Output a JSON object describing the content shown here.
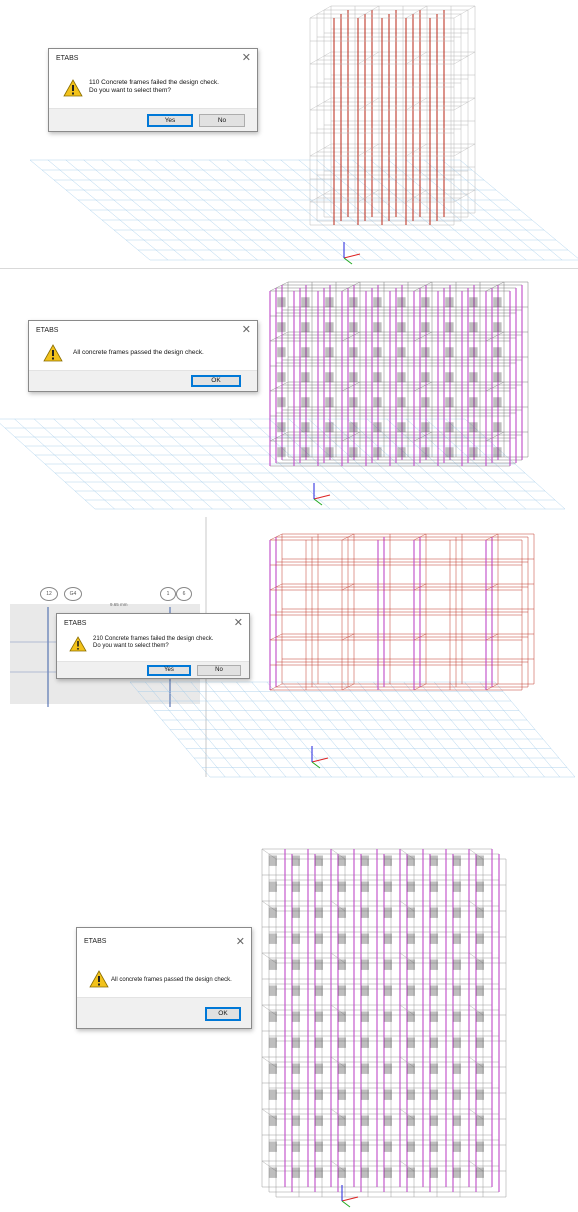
{
  "dialog1": {
    "title": "ETABS",
    "close": "✕",
    "message_line1": "110 Concrete frames failed the design check.",
    "message_line2": "Do you want to select them?",
    "yes_label": "Yes",
    "no_label": "No"
  },
  "dialog2": {
    "title": "ETABS",
    "close": "✕",
    "message": "All concrete frames passed the design check.",
    "ok_label": "OK"
  },
  "dialog3": {
    "title": "ETABS",
    "close": "✕",
    "message_line1": "210 Concrete frames failed the design check.",
    "message_line2": "Do you want to select them?",
    "yes_label": "Yes",
    "no_label": "No"
  },
  "dialog4": {
    "title": "ETABS",
    "close": "✕",
    "message": "All concrete frames passed the design check.",
    "ok_label": "OK"
  },
  "plan_view": {
    "grid_bubble_labels": [
      "12",
      "G4",
      "1",
      "6"
    ],
    "dimension_text": "9.65 mm"
  },
  "icons": {
    "warning": "warning-triangle-icon",
    "axes": "axes-triad-icon"
  },
  "colors": {
    "frame_grey": "#b8b8b8",
    "fail_red": "#c0392b",
    "pass_magenta": "#c04ac8",
    "ground_grid": "#9cc8e8",
    "warning_yellow": "#f2c21b",
    "button_focus": "#0078d7"
  }
}
